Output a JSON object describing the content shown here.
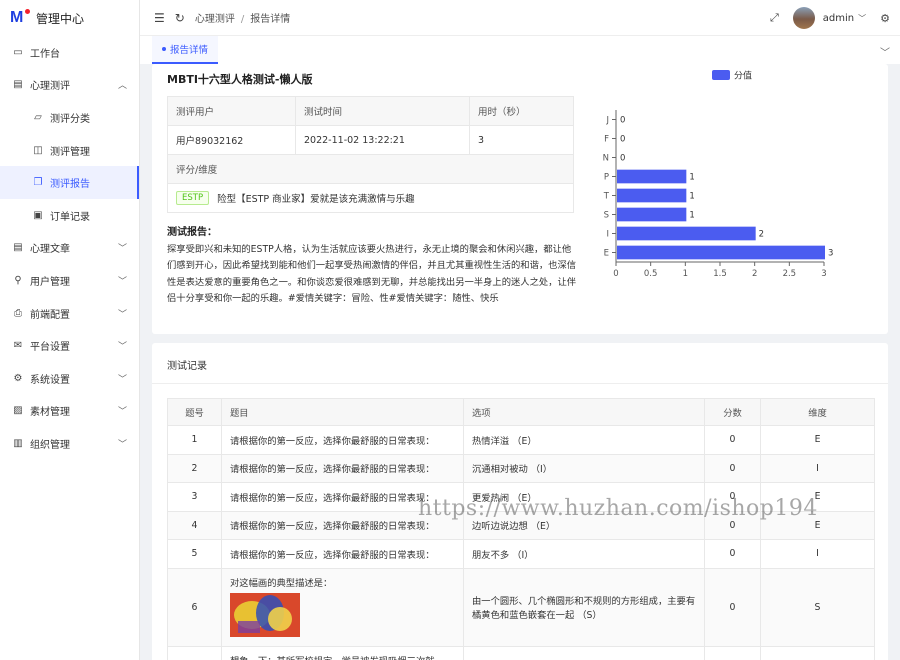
{
  "app": {
    "title": "管理中心",
    "logo_letter": "M"
  },
  "sidebar": {
    "items": [
      {
        "label": "工作台",
        "icon": "monitor-icon",
        "level": 0,
        "expandable": false
      },
      {
        "label": "心理测评",
        "icon": "calculator-icon",
        "level": 0,
        "expandable": true,
        "expanded": true
      },
      {
        "label": "测评分类",
        "icon": "folder-icon",
        "level": 1
      },
      {
        "label": "测评管理",
        "icon": "briefcase-icon",
        "level": 1
      },
      {
        "label": "测评报告",
        "icon": "report-icon",
        "level": 1,
        "active": true
      },
      {
        "label": "订单记录",
        "icon": "order-icon",
        "level": 1
      },
      {
        "label": "心理文章",
        "icon": "article-icon",
        "level": 0,
        "expandable": true
      },
      {
        "label": "用户管理",
        "icon": "user-icon",
        "level": 0,
        "expandable": true
      },
      {
        "label": "前端配置",
        "icon": "printer-icon",
        "level": 0,
        "expandable": true
      },
      {
        "label": "平台设置",
        "icon": "mail-icon",
        "level": 0,
        "expandable": true
      },
      {
        "label": "系统设置",
        "icon": "gear-icon",
        "level": 0,
        "expandable": true
      },
      {
        "label": "素材管理",
        "icon": "image-icon",
        "level": 0,
        "expandable": true
      },
      {
        "label": "组织管理",
        "icon": "building-icon",
        "level": 0,
        "expandable": true
      }
    ]
  },
  "topbar": {
    "breadcrumb": [
      "心理测评",
      "报告详情"
    ],
    "user": "admin"
  },
  "tabs": [
    {
      "label": "报告详情",
      "active": true
    }
  ],
  "report": {
    "title": "MBTI十六型人格测试-懒人版",
    "headers": {
      "user": "测评用户",
      "time": "测试时间",
      "duration": "用时（秒）"
    },
    "values": {
      "user": "用户89032162",
      "time": "2022-11-02 13:22:21",
      "duration": "3"
    },
    "dimension_label": "评分/维度",
    "tag": "ESTP",
    "dimension_text": "险型【ESTP 商业家】爱就是该充满激情与乐趣",
    "report_label": "测试报告：",
    "report_text": "探享受即兴和未知的ESTP人格，认为生活就应该要火热进行，永无止境的聚会和休闲兴趣，都让他们感到开心，因此希望找到能和他们一起享受热闹激情的伴侣，并且尤其重视性生活的和谐，也深信性是表达爱意的重要角色之一。和你谈恋爱很难感到无聊，并总能找出另一半身上的迷人之处，让伴侣十分享受和你一起的乐趣。#爱情关键字：冒险、性#爱情关键字：随性、快乐"
  },
  "chart_data": {
    "type": "bar",
    "orientation": "horizontal",
    "categories": [
      "J",
      "F",
      "N",
      "P",
      "T",
      "S",
      "I",
      "E"
    ],
    "series": [
      {
        "name": "分值",
        "values": [
          0,
          0,
          0,
          1,
          1,
          1,
          2,
          3
        ]
      }
    ],
    "xticks": [
      "0",
      "0.5",
      "1",
      "1.5",
      "2",
      "2.5",
      "3"
    ],
    "xlim": [
      0,
      3
    ],
    "legend": "top-center",
    "color": "#4b5cf0"
  },
  "records": {
    "title": "测试记录",
    "columns": [
      "题号",
      "题目",
      "选项",
      "分数",
      "维度"
    ],
    "rows": [
      {
        "no": "1",
        "q": "请根据你的第一反应，选择你最舒服的日常表现：",
        "opt": "热情洋溢 （E）",
        "score": "0",
        "dim": "E"
      },
      {
        "no": "2",
        "q": "请根据你的第一反应，选择你最舒服的日常表现：",
        "opt": "沉通相对被动 （I）",
        "score": "0",
        "dim": "I"
      },
      {
        "no": "3",
        "q": "请根据你的第一反应，选择你最舒服的日常表现：",
        "opt": "更爱热闹 （E）",
        "score": "0",
        "dim": "E"
      },
      {
        "no": "4",
        "q": "请根据你的第一反应，选择你最舒服的日常表现：",
        "opt": "边听边说边想 （E）",
        "score": "0",
        "dim": "E"
      },
      {
        "no": "5",
        "q": "请根据你的第一反应，选择你最舒服的日常表现：",
        "opt": "朋友不多 （I）",
        "score": "0",
        "dim": "I"
      },
      {
        "no": "6",
        "q": "对这幅画的典型描述是：",
        "opt": "由一个圆形、几个椭圆形和不规则的方形组成，主要有橘黄色和蓝色嵌套在一起 （S）",
        "score": "0",
        "dim": "S",
        "image": true
      },
      {
        "no": "",
        "q": "想象一下：某所军校规定，学员被发现吸烟三次就",
        "opt": "",
        "score": "",
        "dim": ""
      }
    ]
  },
  "watermark": "https://www.huzhan.com/ishop194"
}
